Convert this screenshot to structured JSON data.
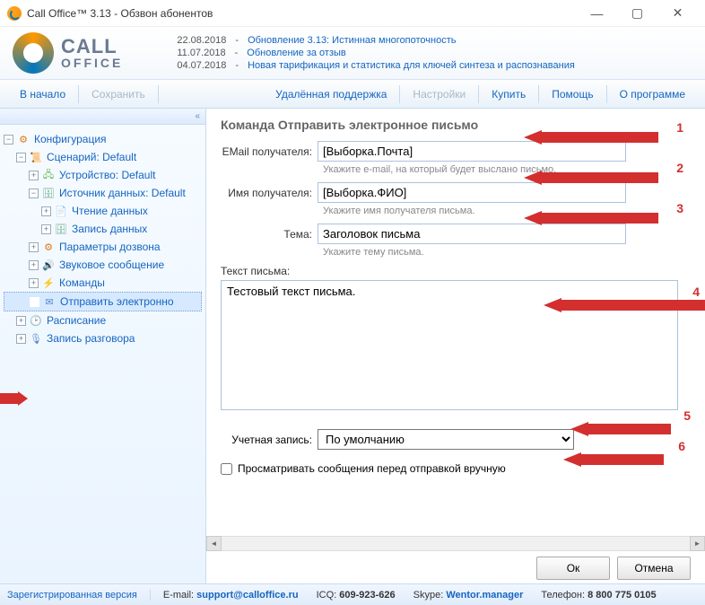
{
  "window": {
    "title": "Call Office™ 3.13 - Обзвон абонентов"
  },
  "logo": {
    "line1": "CALL",
    "line2": "OFFICE"
  },
  "news": [
    {
      "date": "22.08.2018",
      "text": "Обновление 3.13: Истинная многопоточность"
    },
    {
      "date": "11.07.2018",
      "text": "Обновление за отзыв"
    },
    {
      "date": "04.07.2018",
      "text": "Новая тарификация и статистика для ключей синтеза и распознавания"
    }
  ],
  "toolbar": {
    "home": "В начало",
    "save": "Сохранить",
    "remote": "Удалённая поддержка",
    "settings": "Настройки",
    "buy": "Купить",
    "help": "Помощь",
    "about": "О программе"
  },
  "tree": {
    "config": "Конфигурация",
    "scenario": "Сценарий: Default",
    "device": "Устройство: Default",
    "source": "Источник данных: Default",
    "read": "Чтение данных",
    "write": "Запись данных",
    "dial": "Параметры дозвона",
    "sound": "Звуковое сообщение",
    "commands": "Команды",
    "sendmail": "Отправить электронно",
    "schedule": "Расписание",
    "record": "Запись разговора"
  },
  "form": {
    "heading": "Команда Отправить электронное письмо",
    "email_label": "EMail получателя:",
    "email_value": "[Выборка.Почта]",
    "email_hint": "Укажите e-mail, на который будет выслано письмо.",
    "name_label": "Имя получателя:",
    "name_value": "[Выборка.ФИО]",
    "name_hint": "Укажите имя получателя письма.",
    "subject_label": "Тема:",
    "subject_value": "Заголовок письма",
    "subject_hint": "Укажите тему письма.",
    "body_label": "Текст письма:",
    "body_value": "Тестовый текст письма.",
    "account_label": "Учетная запись:",
    "account_value": "По умолчанию",
    "preview_label": "Просматривать сообщения перед отправкой вручную",
    "ok": "Ок",
    "cancel": "Отмена"
  },
  "annotations": {
    "n1": "1",
    "n2": "2",
    "n3": "3",
    "n4": "4",
    "n5": "5",
    "n6": "6"
  },
  "status": {
    "registered": "Зарегистрированная версия",
    "email_label": "E-mail:",
    "email": "support@calloffice.ru",
    "icq_label": "ICQ:",
    "icq": "609-923-626",
    "skype_label": "Skype:",
    "skype": "Wentor.manager",
    "phone_label": "Телефон:",
    "phone": "8 800 775 0105"
  }
}
